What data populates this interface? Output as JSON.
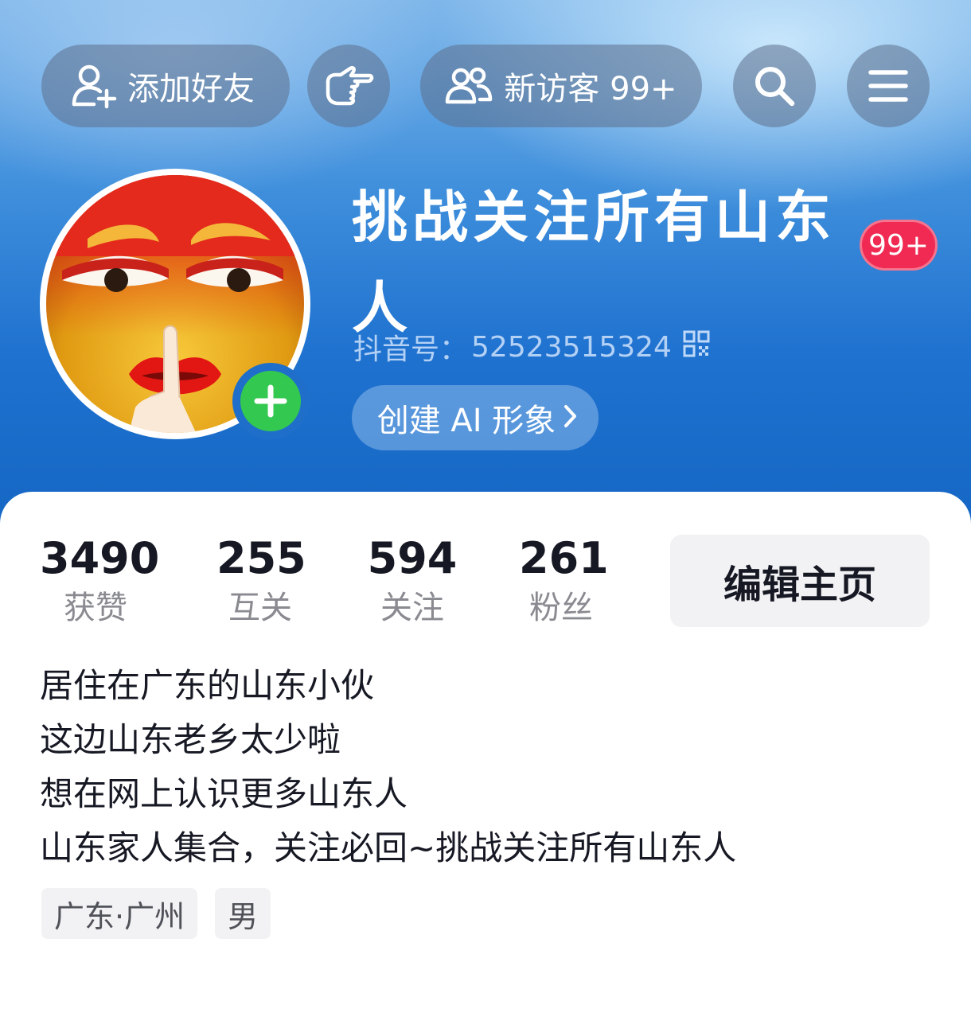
{
  "top_bar": {
    "add_friend_label": "添加好友",
    "add_friend_icon": "add-user-icon",
    "like_icon": "pointing-hand-icon",
    "visitors_label": "新访客 99+",
    "visitors_icon": "users-icon",
    "search_icon": "search-icon",
    "menu_icon": "menu-icon"
  },
  "profile": {
    "avatar": "emoji-avatar",
    "username": "挑战关注所有山东人",
    "notification_count": "99+",
    "douyin_id_label": "抖音号：",
    "douyin_id": "52523515324",
    "create_ai_label": "创建 AI 形象"
  },
  "stats": [
    {
      "value": "3490",
      "label": "获赞"
    },
    {
      "value": "255",
      "label": "互关"
    },
    {
      "value": "594",
      "label": "关注"
    },
    {
      "value": "261",
      "label": "粉丝"
    }
  ],
  "edit_profile_label": "编辑主页",
  "bio": [
    "居住在广东的山东小伙",
    "这边山东老乡太少啦",
    "想在网上认识更多山东人",
    "山东家人集合，关注必回~挑战关注所有山东人"
  ],
  "tags": [
    "广东·广州",
    "男"
  ],
  "colors": {
    "header_blue": "#1f72cf",
    "badge_red": "#f02a52",
    "plus_green": "#33c84f",
    "text_primary": "#161823",
    "text_secondary": "#8a8b91"
  }
}
